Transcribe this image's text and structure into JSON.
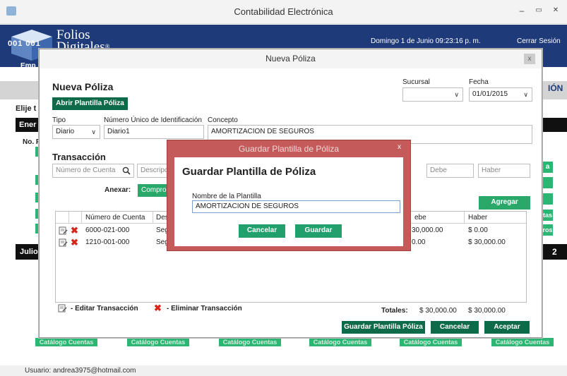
{
  "window": {
    "title": "Contabilidad Electrónica",
    "minimize": "–",
    "maximize": "▭",
    "close": "✕"
  },
  "header": {
    "logo_line1": "Folios",
    "logo_line2": "Digitales",
    "logo_mark": "®",
    "cube_label": "001 001",
    "datetime": "Domingo 1 de Junio 09:23:16 p. m.",
    "logout": "Cerrar Sesión",
    "empresa": "Emp"
  },
  "background": {
    "band_text": "IÓN",
    "elije": "Elije t",
    "ener": "Ener",
    "nof": "No. F",
    "julio": "Julio",
    "right_a": "a",
    "right_tas": "tas",
    "right_ros": "ros",
    "right_2": "2",
    "catalogo_buttons": [
      "Catálogo Cuentas",
      "Catálogo Cuentas",
      "Catálogo Cuentas",
      "Catálogo Cuentas",
      "Catálogo Cuentas",
      "Catálogo Cuentas"
    ]
  },
  "status": {
    "user": "Usuario: andrea3975@hotmail.com"
  },
  "nueva_poliza": {
    "window_title": "Nueva Póliza",
    "close": "x",
    "heading": "Nueva Póliza",
    "abrir_plantilla": "Abrir Plantilla Póliza",
    "sucursal_label": "Sucursal",
    "sucursal_value": "",
    "fecha_label": "Fecha",
    "fecha_value": "01/01/2015",
    "tipo_label": "Tipo",
    "tipo_value": "Diario",
    "numero_label": "Número Único de Identificación",
    "numero_value": "Diario1",
    "concepto_label": "Concepto",
    "concepto_value": "AMORTIZACION DE SEGUROS",
    "transaccion_heading": "Transacción",
    "numero_cuenta_placeholder": "Número de Cuenta",
    "descripcion_placeholder": "Descripci",
    "debe_placeholder": "Debe",
    "haber_placeholder": "Haber",
    "anexar_label": "Anexar:",
    "compro_button": "Compro",
    "agregar_button": "Agregar",
    "columns": {
      "cuenta": "Número de Cuenta",
      "descripcion": "Des",
      "debe": "ebe",
      "haber": "Haber"
    },
    "rows": [
      {
        "cuenta": "6000-021-000",
        "descripcion": "Seg",
        "debe": "30,000.00",
        "haber": "$ 0.00"
      },
      {
        "cuenta": "1210-001-000",
        "descripcion": "Seg",
        "debe": "0.00",
        "haber": "$ 30,000.00"
      }
    ],
    "legend_edit": "- Editar Transacción",
    "legend_delete": "- Eliminar Transacción",
    "totales_label": "Totales:",
    "total_debe": "$ 30,000.00",
    "total_haber": "$ 30,000.00",
    "guardar_plantilla_button": "Guardar Plantilla Póliza",
    "cancelar_button": "Cancelar",
    "aceptar_button": "Aceptar"
  },
  "guardar_plantilla": {
    "window_title": "Guardar Plantilla de Póliza",
    "close": "x",
    "heading": "Guardar Plantilla de Póliza",
    "nombre_label": "Nombre de la Plantilla",
    "nombre_value": "AMORTIZACION DE SEGUROS",
    "cancelar_button": "Cancelar",
    "guardar_button": "Guardar"
  }
}
